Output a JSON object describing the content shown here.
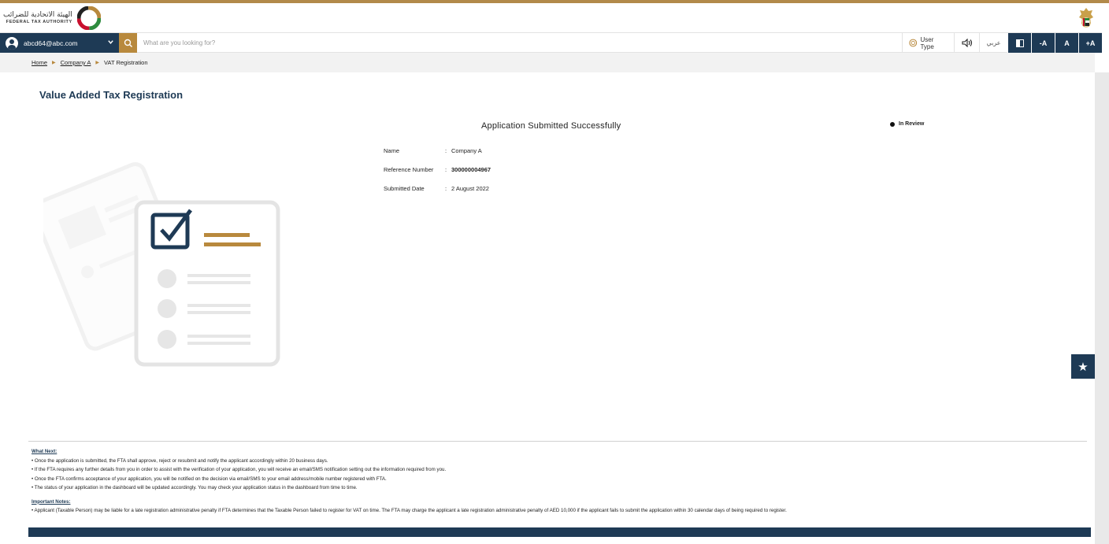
{
  "header": {
    "logo_ar": "الهيئة الاتحادية للضرائب",
    "logo_en": "FEDERAL TAX AUTHORITY"
  },
  "navbar": {
    "user_email": "abcd64@abc.com",
    "search_placeholder": "What are you looking for?",
    "user_type_label": "User Type",
    "lang_label": "عربي",
    "font_decrease": "-A",
    "font_reset": "A",
    "font_increase": "+A"
  },
  "breadcrumb": {
    "home": "Home",
    "company": "Company A",
    "current": "VAT Registration"
  },
  "page": {
    "title": "Value Added Tax Registration",
    "success_title": "Application Submitted Successfully",
    "status": "In Review"
  },
  "details": {
    "name_label": "Name",
    "name_value": "Company A",
    "ref_label": "Reference Number",
    "ref_value": "300000004967",
    "date_label": "Submitted Date",
    "date_value": "2 August 2022",
    "separator": ":"
  },
  "notes": {
    "what_next_heading": "What Next:",
    "what_next": [
      "• Once the application is submitted, the FTA shall approve, reject or resubmit and notify the applicant accordingly within 20 business days.",
      "• If the FTA requires any further details from you in order to assist with the verification of your application, you will receive an email/SMS notification setting out the information required from you.",
      "• Once the FTA confirms acceptance of your application, you will be notified on the decision via email/SMS to your email address/mobile number registered with FTA.",
      "• The status of your application in the dashboard will be updated accordingly. You may check your application status in the dashboard from time to time."
    ],
    "important_heading": "Important Notes:",
    "important": [
      "• Applicant (Taxable Person) may be liable for a late registration administrative penalty if FTA determines that the Taxable Person failed to register for VAT on time. The FTA may charge the applicant a late registration administrative penalty of AED 10,000 if the applicant fails to submit the application within 30 calendar days of being required to register."
    ]
  },
  "colors": {
    "primary": "#1e3a55",
    "accent": "#b8893d"
  },
  "icons": {
    "favourite": "star-icon"
  }
}
